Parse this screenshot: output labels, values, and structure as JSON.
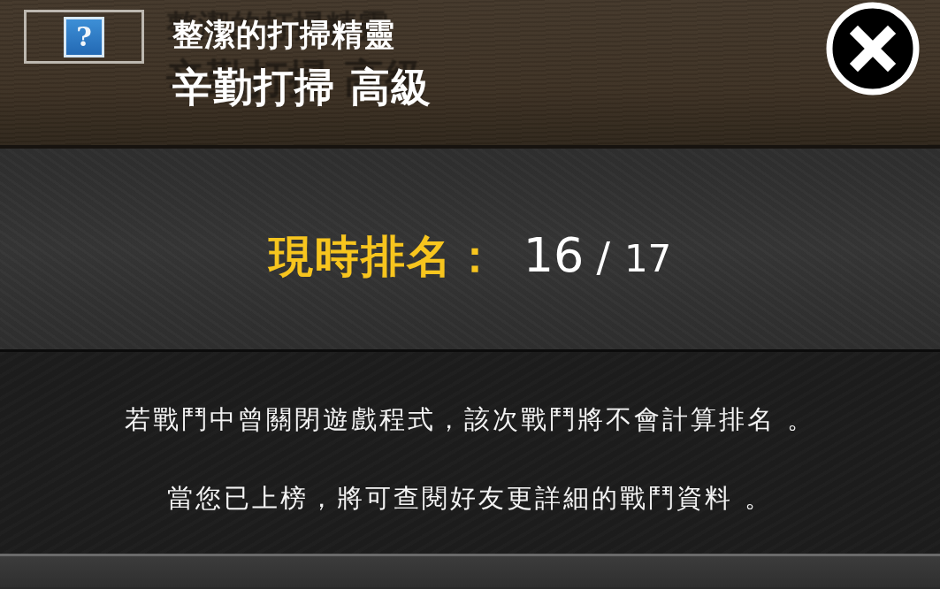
{
  "header": {
    "help": {
      "icon": "?"
    },
    "title": "整潔的打掃精靈",
    "subtitle": "辛勤打掃 高級"
  },
  "ranking": {
    "label": "現時排名：",
    "current": "16",
    "separator": "/",
    "total": "17"
  },
  "notes": [
    "若戰鬥中曾關閉遊戲程式，該次戰鬥將不會計算排名 。",
    "當您已上榜，將可查閱好友更詳細的戰鬥資料 。"
  ]
}
